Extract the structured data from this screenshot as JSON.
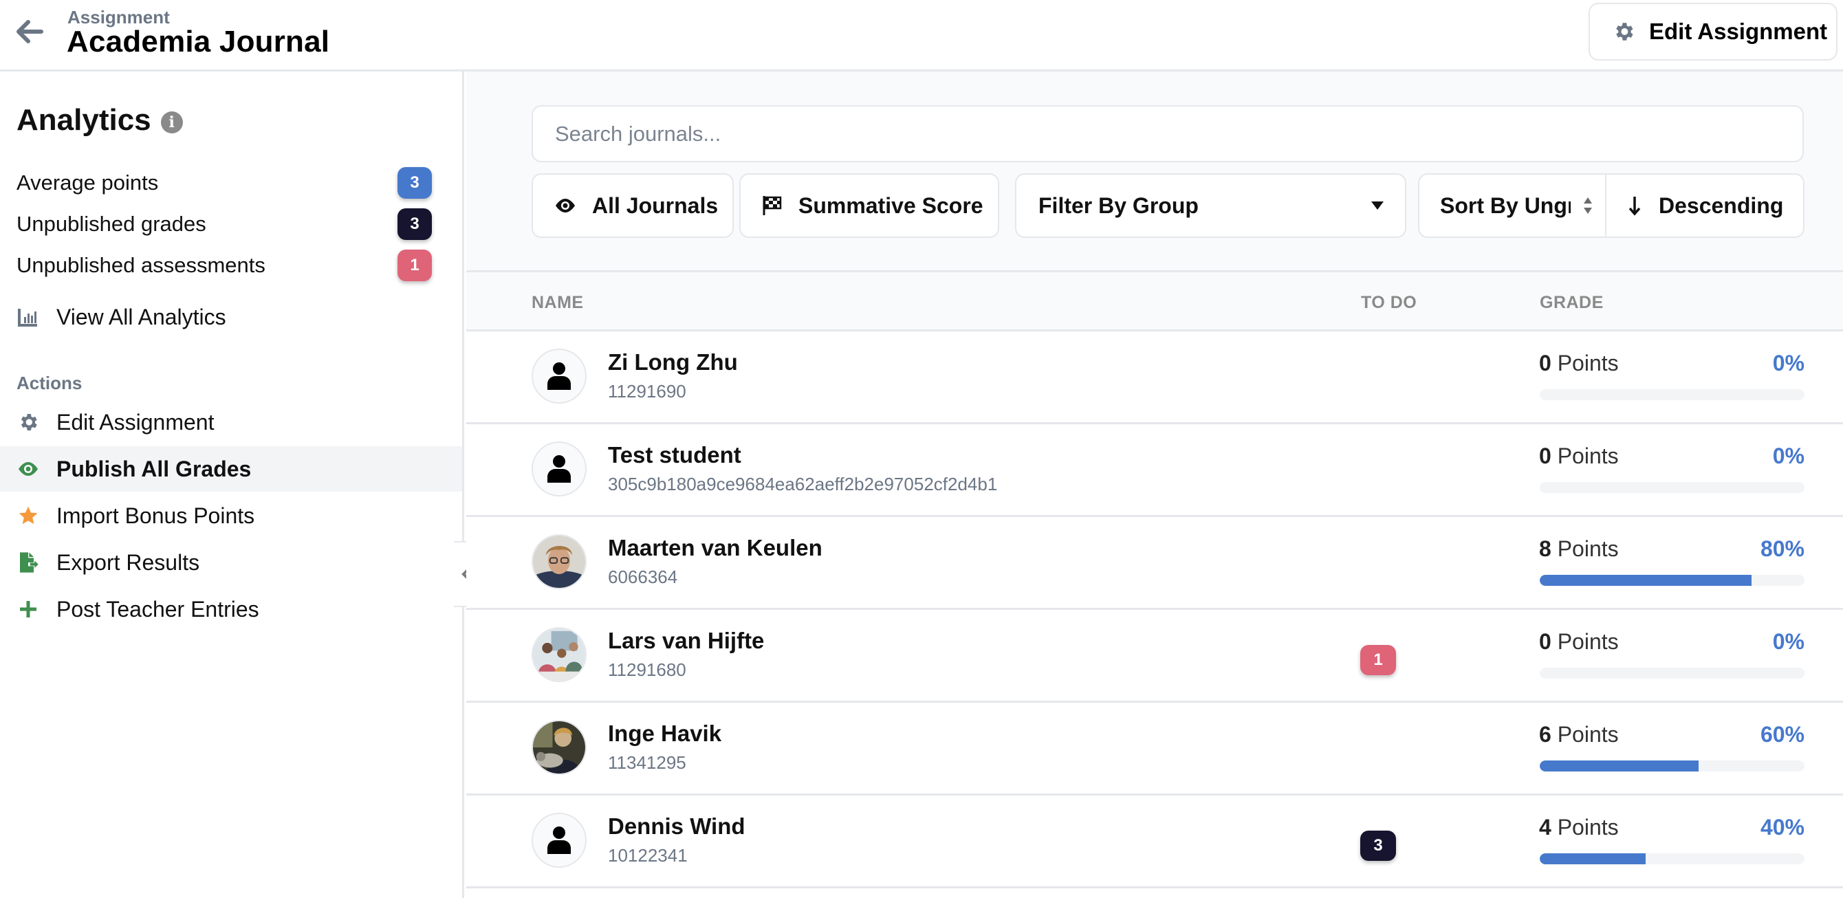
{
  "header": {
    "subtitle": "Assignment",
    "title": "Academia Journal",
    "edit_button": "Edit Assignment"
  },
  "sidebar": {
    "analytics_title": "Analytics",
    "stats": [
      {
        "label": "Average points",
        "value": "3",
        "color": "#4679cc"
      },
      {
        "label": "Unpublished grades",
        "value": "3",
        "color": "#16142e"
      },
      {
        "label": "Unpublished assessments",
        "value": "1",
        "color": "#df6478"
      }
    ],
    "view_all": "View All Analytics",
    "actions_label": "Actions",
    "actions": [
      {
        "label": "Edit Assignment",
        "icon": "gear-icon"
      },
      {
        "label": "Publish All Grades",
        "icon": "eye-icon",
        "active": true
      },
      {
        "label": "Import Bonus Points",
        "icon": "star-icon"
      },
      {
        "label": "Export Results",
        "icon": "file-export-icon"
      },
      {
        "label": "Post Teacher Entries",
        "icon": "plus-icon"
      }
    ]
  },
  "toolbar": {
    "search_placeholder": "Search journals...",
    "search_value": "",
    "all_journals": "All Journals",
    "summative_score": "Summative Score",
    "filter_group": "Filter By Group",
    "sort_by": "Sort By Ungraded",
    "sort_by_visible": "Sort By Ungr",
    "sort_direction": "Descending"
  },
  "table": {
    "columns": [
      "NAME",
      "TO DO",
      "GRADE"
    ],
    "points_label": "Points",
    "rows": [
      {
        "name": "Zi Long Zhu",
        "id": "11291690",
        "avatar": "default",
        "todo": null,
        "points": "0",
        "percent": "0%",
        "progress": 0
      },
      {
        "name": "Test student",
        "id": "305c9b180a9ce9684ea62aeff2b2e97052cf2d4b1",
        "avatar": "default",
        "todo": null,
        "points": "0",
        "percent": "0%",
        "progress": 0
      },
      {
        "name": "Maarten van Keulen",
        "id": "6066364",
        "avatar": "photo-man-glasses",
        "todo": null,
        "points": "8",
        "percent": "80%",
        "progress": 80
      },
      {
        "name": "Lars van Hijfte",
        "id": "11291680",
        "avatar": "photo-group",
        "todo": {
          "value": "1",
          "color": "#df6478"
        },
        "points": "0",
        "percent": "0%",
        "progress": 0
      },
      {
        "name": "Inge Havik",
        "id": "11341295",
        "avatar": "photo-person-cat",
        "todo": null,
        "points": "6",
        "percent": "60%",
        "progress": 60
      },
      {
        "name": "Dennis Wind",
        "id": "10122341",
        "avatar": "default",
        "todo": {
          "value": "3",
          "color": "#16142e"
        },
        "points": "4",
        "percent": "40%",
        "progress": 40
      }
    ]
  },
  "colors": {
    "accent": "#4679cc",
    "dark_badge": "#16142e",
    "danger_badge": "#df6478",
    "green_icon": "#3f8f4f",
    "star": "#f59a3c",
    "muted": "#6b7685"
  }
}
